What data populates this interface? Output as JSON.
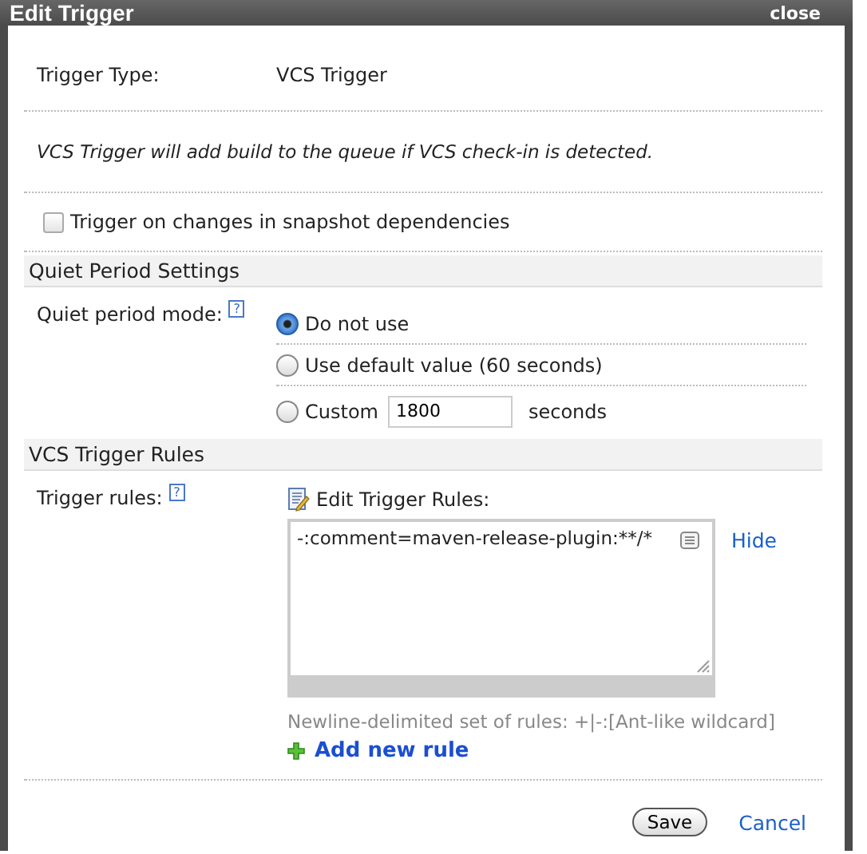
{
  "dialog": {
    "title": "Edit Trigger",
    "close": "close"
  },
  "trigger_type": {
    "label": "Trigger Type:",
    "value": "VCS Trigger"
  },
  "description": "VCS Trigger will add build to the queue if VCS check-in is detected.",
  "snapshot_checkbox": {
    "label": "Trigger on changes in snapshot dependencies",
    "checked": false
  },
  "quiet_section": {
    "title": "Quiet Period Settings",
    "label": "Quiet period mode:",
    "help": "?",
    "options": [
      {
        "label": "Do not use",
        "selected": true
      },
      {
        "label": "Use default value (60 seconds)",
        "selected": false
      },
      {
        "label": "Custom",
        "selected": false,
        "value": "1800",
        "unit": "seconds"
      }
    ]
  },
  "rules_section": {
    "title": "VCS Trigger Rules",
    "label": "Trigger rules:",
    "help": "?",
    "editor_title": "Edit Trigger Rules:",
    "rules": "-:comment=maven-release-plugin:**/*",
    "hide": "Hide",
    "hint": "Newline-delimited set of rules: +|-:[Ant-like wildcard]",
    "add_rule": "Add new rule"
  },
  "buttons": {
    "save": "Save",
    "cancel": "Cancel"
  }
}
